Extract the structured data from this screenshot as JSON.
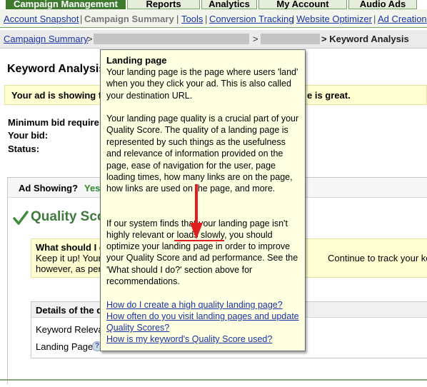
{
  "tabs": [
    {
      "label": "Campaign Management",
      "active": true
    },
    {
      "label": "Reports",
      "active": false
    },
    {
      "label": "Analytics",
      "active": false
    },
    {
      "label": "My Account",
      "active": false
    },
    {
      "label": "Audio Ads",
      "active": false
    }
  ],
  "subnav": {
    "items": [
      "Account Snapshot",
      "Campaign Summary",
      "Tools",
      "Conversion Tracking",
      "Website Optimizer",
      "Ad Creation"
    ]
  },
  "breadcrumb": {
    "root": "Campaign Summary",
    "sep": ">",
    "current": "> Keyword Analysis"
  },
  "page_title": "Keyword Analysis",
  "banner": {
    "left": "Your ad is showing fo",
    "right": "e is great."
  },
  "fields": {
    "min_bid": "Minimum bid require",
    "your_bid": "Your bid:",
    "status": "Status:"
  },
  "ad_showing": {
    "label": "Ad Showing?",
    "value": "Yes"
  },
  "quality_score": {
    "title": "Quality Sco"
  },
  "what_box": {
    "title": "What should I c",
    "line2": "Keep it up! Your",
    "line3": "however, as perfo",
    "right": "Continue to track your keywo"
  },
  "details": {
    "header": "Details of the q",
    "row1": "Keyword Relevan",
    "row2": "Landing Page",
    "help": "?"
  },
  "tooltip": {
    "title": "Landing page",
    "para1": "Your landing page is the page where users 'land' when you they click your ad. This is also called your destination URL.",
    "para2": "Your landing page quality is a crucial part of your Quality Score. The quality of a landing page is represented by such things as the usefulness and relevance of information provided on the page, ease of navigation for the user, page loading times, how many links are on the page, how links are used on the page, and more.",
    "para3_a": "If our system finds that your landing page isn't",
    "para3_b": "highly relevant or loads slowly, you should",
    "para3_c": "optimize your landing page in order to improve your Quality Score and ad performance. See the 'What should I do?' section above for recommendations.",
    "links": [
      "How do I create a high quality landing page?",
      "How often do you visit landing pages and update",
      "Quality Scores?",
      "How is my keyword's Quality Score used?"
    ]
  },
  "colors": {
    "brand_green": "#3e7a2f",
    "link_blue": "#1a33a6",
    "tooltip_bg": "#ffffe1",
    "highlight_yellow": "#ffffd2",
    "annotation_red": "#e02020"
  }
}
